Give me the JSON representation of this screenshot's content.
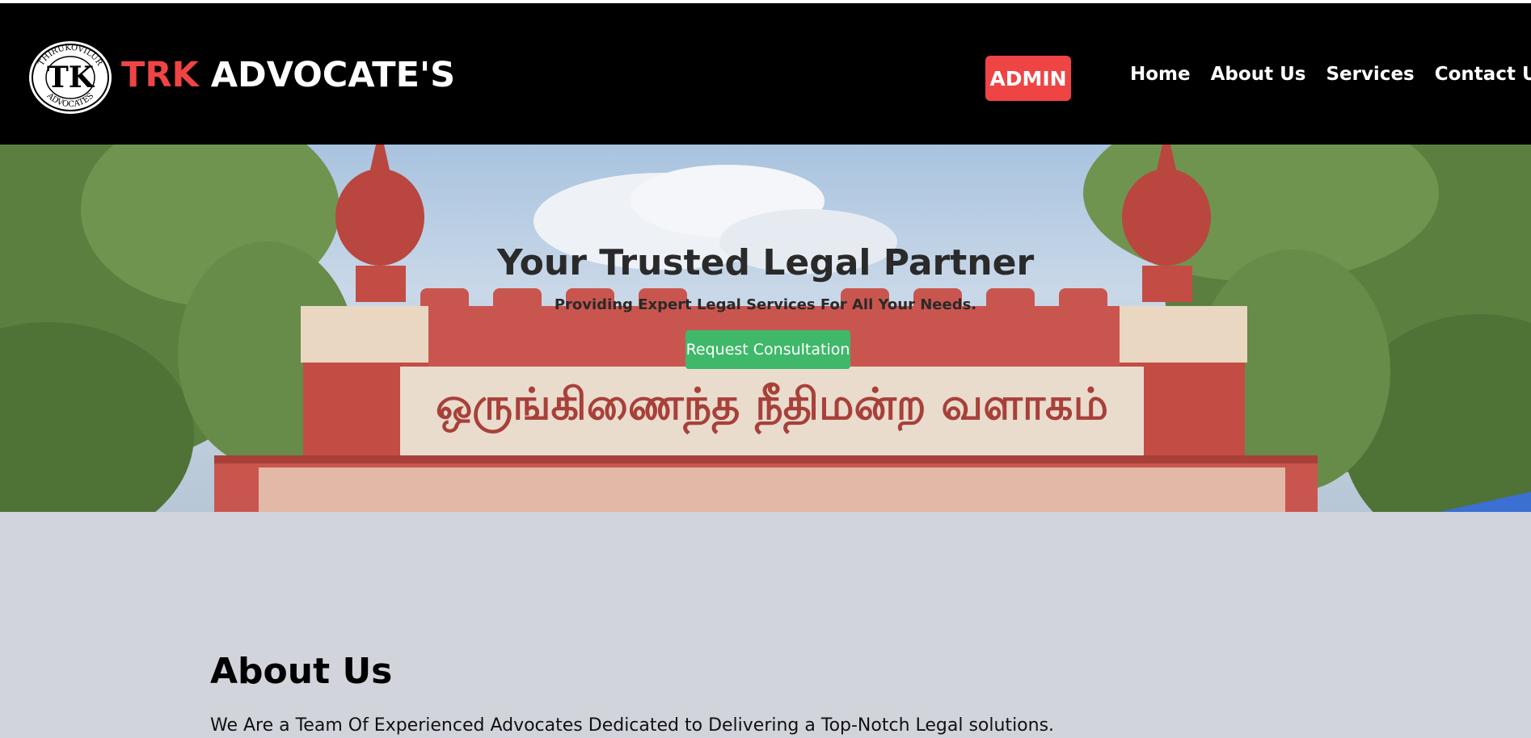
{
  "header": {
    "brand_part1": "TRK",
    "brand_part2": "ADVOCATE'S",
    "logo_text_top": "THIRUKOVILUR",
    "logo_text_bottom": "ADVOCATES",
    "logo_monogram": "TK",
    "admin_label": "ADMIN",
    "nav": [
      {
        "label": "Home"
      },
      {
        "label": "About Us"
      },
      {
        "label": "Services"
      },
      {
        "label": "Contact Us"
      }
    ]
  },
  "hero": {
    "title": "Your Trusted Legal Partner",
    "subtitle": "Providing Expert Legal Services For All Your Needs.",
    "cta_label": "Request Consultation",
    "arch_text": "ஒருங்கிணைந்த நீதிமன்ற வளாகம்"
  },
  "about": {
    "heading": "About Us",
    "text": "We Are a Team Of Experienced Advocates Dedicated to Delivering a Top-Notch Legal solutions."
  },
  "colors": {
    "header_bg": "#000000",
    "brand_red": "#ef4444",
    "admin_bg": "#ef4444",
    "cta_bg": "#3fb86a",
    "page_bg": "#d1d5db"
  }
}
